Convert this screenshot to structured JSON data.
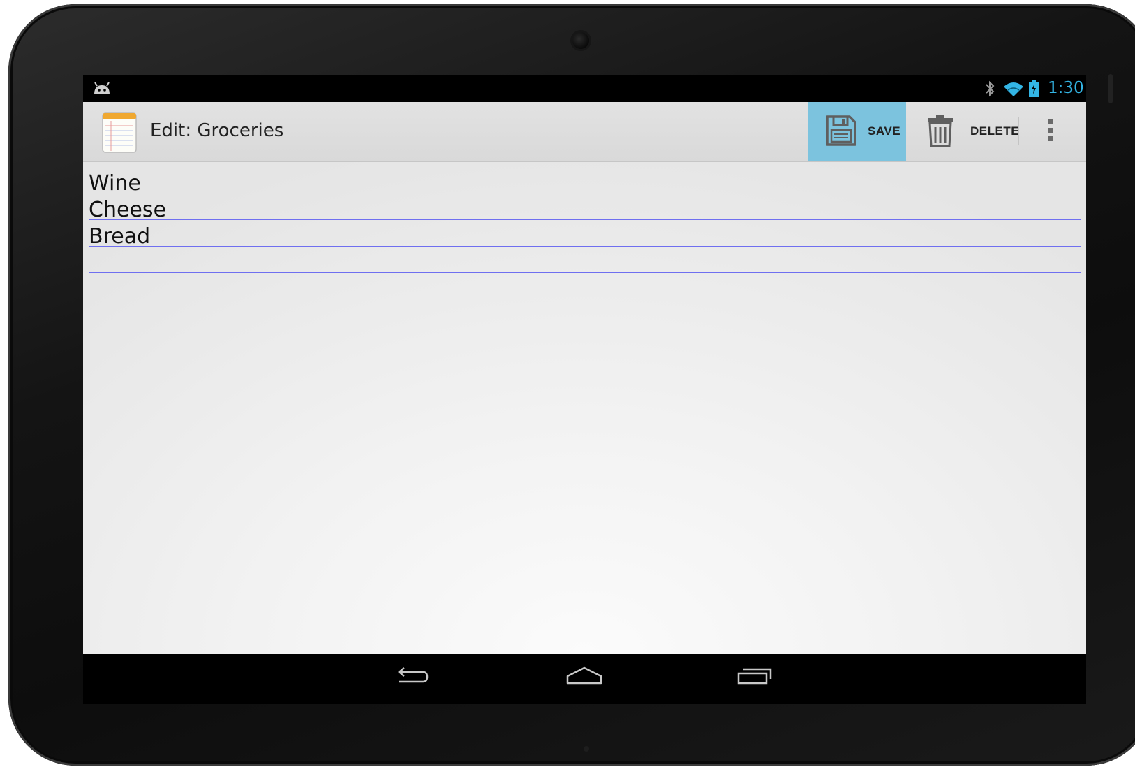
{
  "status_bar": {
    "time": "1:30",
    "icons": [
      "android-icon",
      "bluetooth-icon",
      "wifi-icon",
      "battery-charging-icon"
    ],
    "accent_color": "#33b5e5"
  },
  "action_bar": {
    "title": "Edit: Groceries",
    "app_icon": "notepad-icon",
    "actions": [
      {
        "label": "SAVE",
        "icon": "save-floppy-icon",
        "highlighted": true,
        "highlight_color": "#7cc3de"
      },
      {
        "label": "DELETE",
        "icon": "trash-icon",
        "highlighted": false
      }
    ],
    "overflow_icon": "overflow-menu-icon"
  },
  "note": {
    "lines": [
      "Wine",
      "Cheese",
      "Bread",
      ""
    ],
    "rule_color": "#6f6ff0"
  },
  "nav_bar": {
    "buttons": [
      "back-icon",
      "home-icon",
      "recents-icon"
    ]
  }
}
